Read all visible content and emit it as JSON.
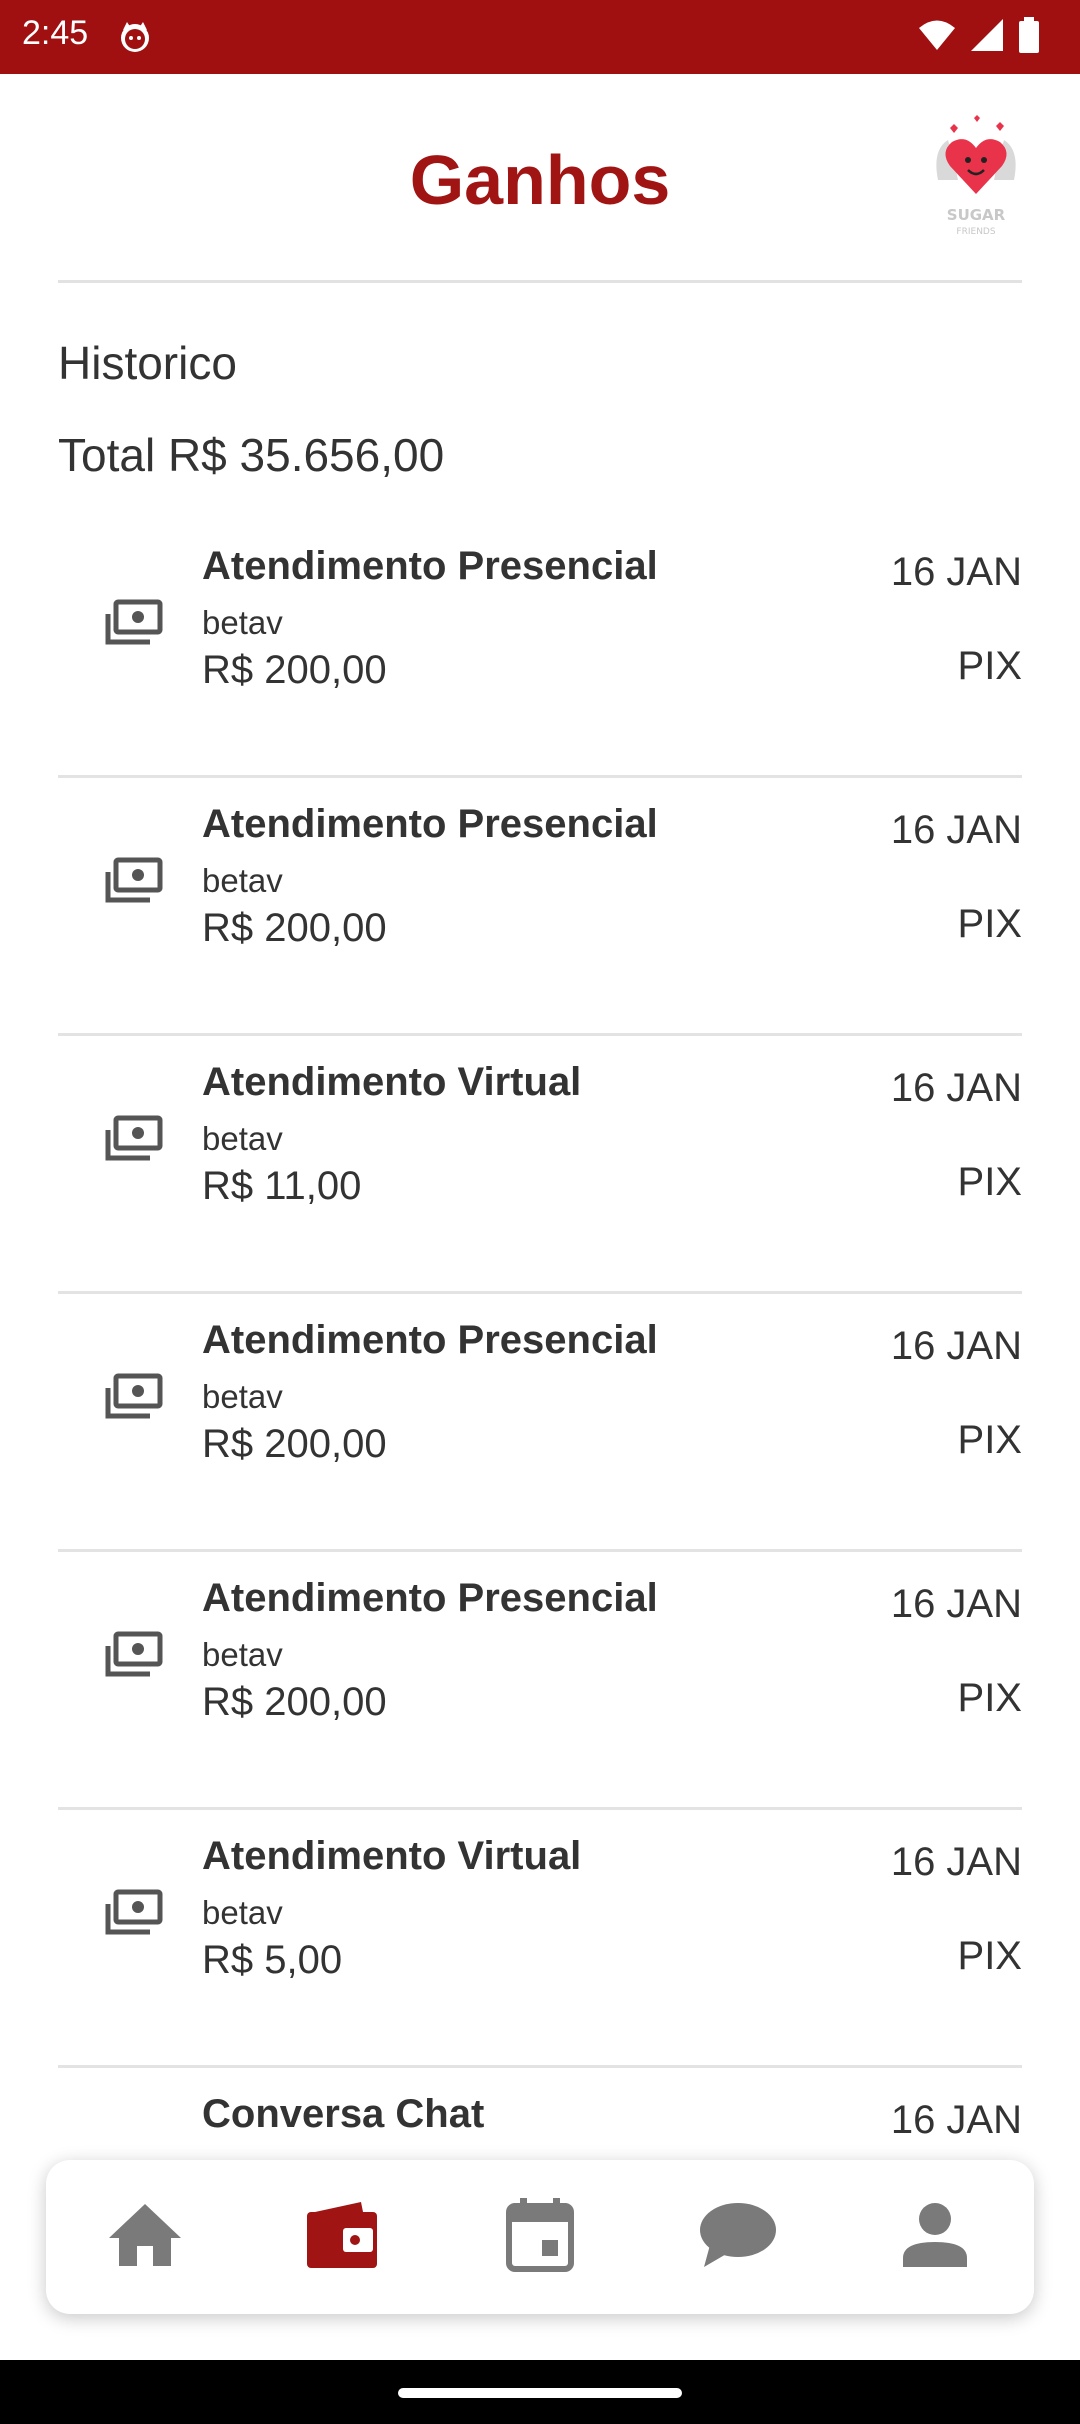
{
  "status_bar": {
    "time": "2:45",
    "icons": [
      "cat-notification-icon",
      "wifi-icon",
      "signal-icon",
      "battery-icon"
    ]
  },
  "header": {
    "title": "Ganhos",
    "logo_icon": "sugar-friends-logo-icon",
    "logo_text": "SUGAR FRIENDS"
  },
  "section_title": "Historico",
  "total_label": "Total R$ 35.656,00",
  "transactions": [
    {
      "title": "Atendimento Presencial",
      "client": "betav",
      "amount": "R$ 200,00",
      "date": "16 JAN",
      "method": "PIX"
    },
    {
      "title": "Atendimento Presencial",
      "client": "betav",
      "amount": "R$ 200,00",
      "date": "16 JAN",
      "method": "PIX"
    },
    {
      "title": "Atendimento Virtual",
      "client": "betav",
      "amount": "R$ 11,00",
      "date": "16 JAN",
      "method": "PIX"
    },
    {
      "title": "Atendimento Presencial",
      "client": "betav",
      "amount": "R$ 200,00",
      "date": "16 JAN",
      "method": "PIX"
    },
    {
      "title": "Atendimento Presencial",
      "client": "betav",
      "amount": "R$ 200,00",
      "date": "16 JAN",
      "method": "PIX"
    },
    {
      "title": "Atendimento Virtual",
      "client": "betav",
      "amount": "R$ 5,00",
      "date": "16 JAN",
      "method": "PIX"
    },
    {
      "title": "Conversa Chat",
      "client": "",
      "amount": "",
      "date": "16 JAN",
      "method": ""
    }
  ],
  "bottom_nav": {
    "items": [
      "home-icon",
      "wallet-icon",
      "calendar-icon",
      "chat-icon",
      "profile-icon"
    ],
    "active": "wallet-icon"
  },
  "colors": {
    "brand": "#a01414",
    "status_bar": "#a01010",
    "nav_inactive": "#7a7a7a",
    "divider": "#e3e3e3"
  }
}
